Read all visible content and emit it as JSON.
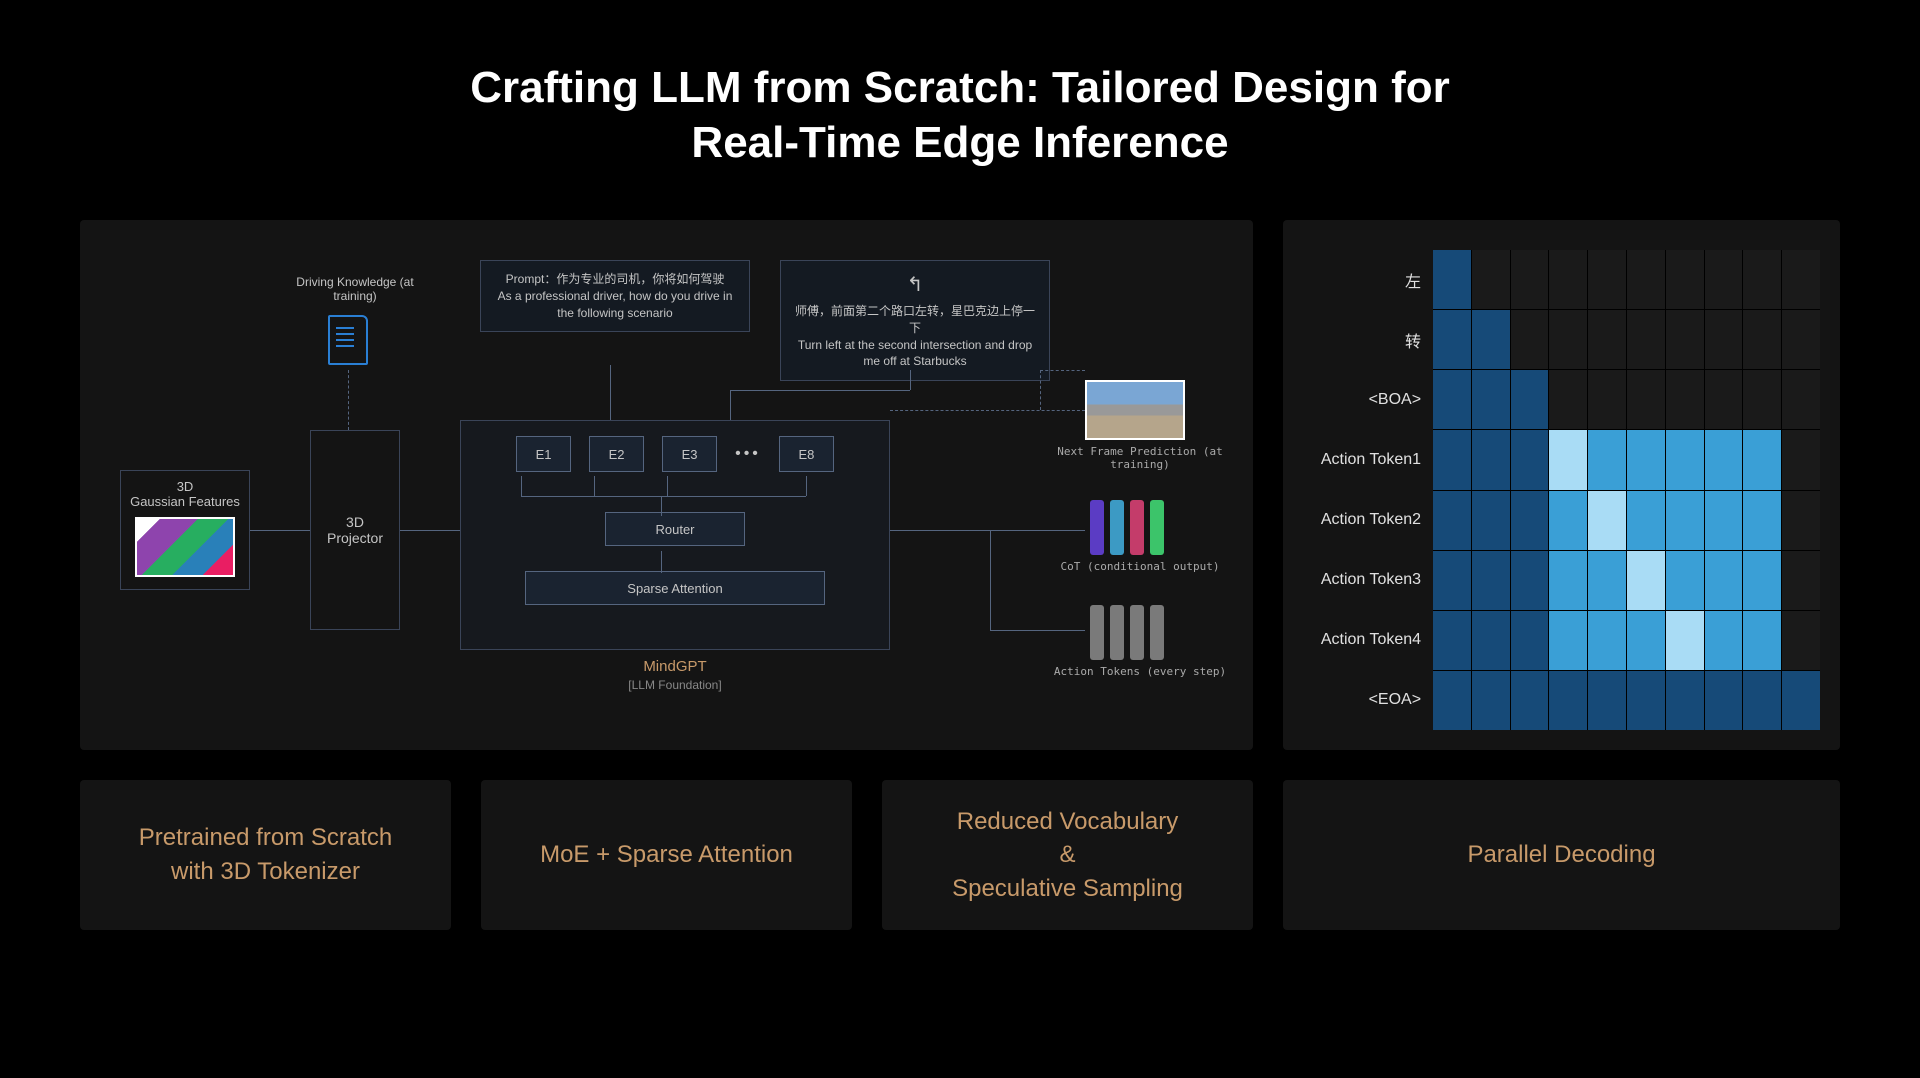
{
  "title_line1": "Crafting LLM from Scratch: Tailored Design for",
  "title_line2": "Real-Time Edge Inference",
  "left": {
    "doc_label": "Driving Knowledge (at training)",
    "gaussian": "3D\nGaussian Features",
    "projector": "3D\nProjector",
    "mindgpt": "MindGPT",
    "mindgpt_sub": "[LLM Foundation]",
    "experts": [
      "E1",
      "E2",
      "E3",
      "E8"
    ],
    "router": "Router",
    "sparse": "Sparse Attention",
    "prompt1_cn": "Prompt：作为专业的司机，你将如何驾驶",
    "prompt1_en": "As a professional driver, how do you drive in the following scenario",
    "prompt2_cn": "师傅，前面第二个路口左转，星巴克边上停一下",
    "prompt2_en": "Turn left at the second intersection and drop me off at Starbucks",
    "next_frame": "Next Frame Prediction (at training)",
    "cot": "CoT (conditional output)",
    "action_tokens": "Action Tokens (every step)"
  },
  "right": {
    "labels": [
      "左",
      "转",
      "<BOA>",
      "Action Token1",
      "Action Token2",
      "Action Token3",
      "Action Token4",
      "<EOA>"
    ]
  },
  "cards": {
    "c1": "Pretrained from Scratch\nwith 3D Tokenizer",
    "c2": "MoE + Sparse Attention",
    "c3": "Reduced Vocabulary\n&\nSpeculative Sampling",
    "c4": "Parallel Decoding"
  },
  "chart_data": {
    "type": "heatmap",
    "rows": [
      "左",
      "转",
      "<BOA>",
      "Action Token1",
      "Action Token2",
      "Action Token3",
      "Action Token4",
      "<EOA>"
    ],
    "legend": {
      "0": "empty",
      "1": "dark-blue",
      "2": "mid-blue",
      "3": "light-blue"
    },
    "matrix": [
      [
        1,
        0,
        0,
        0,
        0,
        0,
        0,
        0,
        0,
        0
      ],
      [
        1,
        1,
        0,
        0,
        0,
        0,
        0,
        0,
        0,
        0
      ],
      [
        1,
        1,
        1,
        0,
        0,
        0,
        0,
        0,
        0,
        0
      ],
      [
        1,
        1,
        1,
        3,
        2,
        2,
        2,
        2,
        2,
        0
      ],
      [
        1,
        1,
        1,
        2,
        3,
        2,
        2,
        2,
        2,
        0
      ],
      [
        1,
        1,
        1,
        2,
        2,
        3,
        2,
        2,
        2,
        0
      ],
      [
        1,
        1,
        1,
        2,
        2,
        2,
        3,
        2,
        2,
        0
      ],
      [
        1,
        1,
        1,
        1,
        1,
        1,
        1,
        1,
        1,
        1
      ]
    ]
  }
}
